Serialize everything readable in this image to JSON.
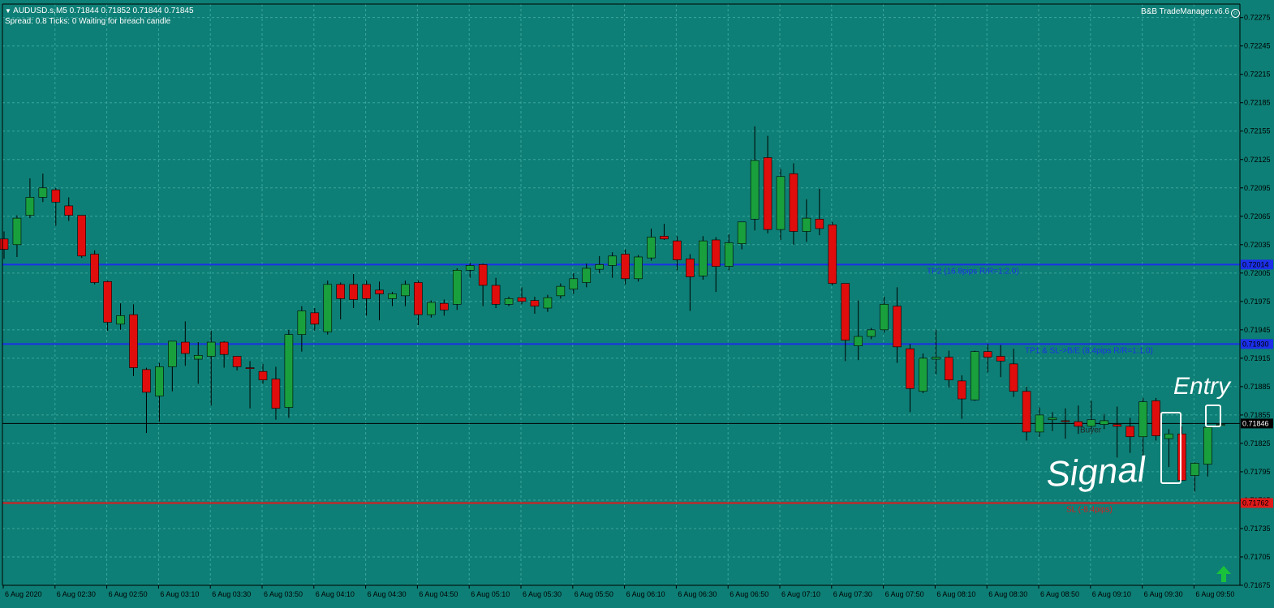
{
  "header": {
    "symbol_line": "AUDUSD.s,M5  0.71844 0.71852 0.71844 0.71845",
    "status_line": "Spread: 0.8   Ticks: 0   Waiting for breach candle",
    "ea_name": "B&B TradeManager.v6.6"
  },
  "colors": {
    "background": "#0e7f76",
    "grid": "#3aa79d",
    "bull_candle": "#19a03c",
    "bear_candle": "#e00d0d",
    "tp_line": "#1b30e8",
    "sl_line": "#e01a1a",
    "price_line": "#000000",
    "annotation": "#ffffff"
  },
  "levels": {
    "tp2": {
      "price": 0.72014,
      "tag": "0.72014",
      "label": "TP2 (16.8pips R/R=1:2.0)"
    },
    "tp1": {
      "price": 0.7193,
      "tag": "0.71930",
      "label": "TP1 & SL->B/E (8.4pips R/R=1:1.0)"
    },
    "current": {
      "price": 0.71846,
      "tag": "0.71846"
    },
    "sl": {
      "price": 0.71762,
      "tag": "0.71762",
      "label": "SL (-8.4pips)"
    },
    "order_label": "Buyer"
  },
  "annotations": {
    "signal": "Signal",
    "entry": "Entry"
  },
  "chart_data": {
    "type": "candlestick",
    "symbol": "AUDUSD.s",
    "timeframe": "M5",
    "ylim": [
      0.71675,
      0.72285
    ],
    "y_ticks": [
      "0.72275",
      "0.72245",
      "0.72215",
      "0.72185",
      "0.72155",
      "0.72125",
      "0.72095",
      "0.72065",
      "0.72035",
      "0.72005",
      "0.71975",
      "0.71945",
      "0.71915",
      "0.71885",
      "0.71855",
      "0.71825",
      "0.71795",
      "0.71765",
      "0.71735",
      "0.71705",
      "0.71675"
    ],
    "x_ticks": [
      "6 Aug 2020",
      "6 Aug 02:30",
      "6 Aug 02:50",
      "6 Aug 03:10",
      "6 Aug 03:30",
      "6 Aug 03:50",
      "6 Aug 04:10",
      "6 Aug 04:30",
      "6 Aug 04:50",
      "6 Aug 05:10",
      "6 Aug 05:30",
      "6 Aug 05:50",
      "6 Aug 06:10",
      "6 Aug 06:30",
      "6 Aug 06:50",
      "6 Aug 07:10",
      "6 Aug 07:30",
      "6 Aug 07:50",
      "6 Aug 08:10",
      "6 Aug 08:30",
      "6 Aug 08:50",
      "6 Aug 09:10",
      "6 Aug 09:30",
      "6 Aug 09:50"
    ],
    "grid": true,
    "candles": [
      {
        "o": 0.72041,
        "h": 0.72049,
        "l": 0.7202,
        "c": 0.7203
      },
      {
        "o": 0.72035,
        "h": 0.72066,
        "l": 0.72022,
        "c": 0.72063
      },
      {
        "o": 0.72066,
        "h": 0.72105,
        "l": 0.72063,
        "c": 0.72085
      },
      {
        "o": 0.72085,
        "h": 0.7211,
        "l": 0.7208,
        "c": 0.72095
      },
      {
        "o": 0.72093,
        "h": 0.72095,
        "l": 0.72055,
        "c": 0.7208
      },
      {
        "o": 0.72076,
        "h": 0.72085,
        "l": 0.7206,
        "c": 0.72066
      },
      {
        "o": 0.72066,
        "h": 0.72066,
        "l": 0.72021,
        "c": 0.72023
      },
      {
        "o": 0.72025,
        "h": 0.72029,
        "l": 0.71993,
        "c": 0.71995
      },
      {
        "o": 0.71996,
        "h": 0.71997,
        "l": 0.71944,
        "c": 0.71953
      },
      {
        "o": 0.71951,
        "h": 0.71973,
        "l": 0.71945,
        "c": 0.7196
      },
      {
        "o": 0.71961,
        "h": 0.71972,
        "l": 0.71896,
        "c": 0.71905
      },
      {
        "o": 0.71903,
        "h": 0.71905,
        "l": 0.71836,
        "c": 0.71879
      },
      {
        "o": 0.71875,
        "h": 0.7191,
        "l": 0.71848,
        "c": 0.71906
      },
      {
        "o": 0.71906,
        "h": 0.71933,
        "l": 0.7188,
        "c": 0.71933
      },
      {
        "o": 0.71932,
        "h": 0.71954,
        "l": 0.71907,
        "c": 0.7192
      },
      {
        "o": 0.71914,
        "h": 0.71932,
        "l": 0.71888,
        "c": 0.71918
      },
      {
        "o": 0.71917,
        "h": 0.71944,
        "l": 0.71865,
        "c": 0.71932
      },
      {
        "o": 0.71932,
        "h": 0.71933,
        "l": 0.71905,
        "c": 0.71919
      },
      {
        "o": 0.71917,
        "h": 0.71917,
        "l": 0.71902,
        "c": 0.71906
      },
      {
        "o": 0.71905,
        "h": 0.71912,
        "l": 0.71862,
        "c": 0.71904
      },
      {
        "o": 0.71901,
        "h": 0.71909,
        "l": 0.71888,
        "c": 0.71892
      },
      {
        "o": 0.71893,
        "h": 0.71906,
        "l": 0.7185,
        "c": 0.71862
      },
      {
        "o": 0.71863,
        "h": 0.71945,
        "l": 0.71852,
        "c": 0.7194
      },
      {
        "o": 0.7194,
        "h": 0.7197,
        "l": 0.71922,
        "c": 0.71965
      },
      {
        "o": 0.71963,
        "h": 0.71968,
        "l": 0.71944,
        "c": 0.71951
      },
      {
        "o": 0.71943,
        "h": 0.71997,
        "l": 0.7194,
        "c": 0.71993
      },
      {
        "o": 0.71993,
        "h": 0.71995,
        "l": 0.71956,
        "c": 0.71978
      },
      {
        "o": 0.71993,
        "h": 0.72004,
        "l": 0.71968,
        "c": 0.71977
      },
      {
        "o": 0.71993,
        "h": 0.71997,
        "l": 0.7196,
        "c": 0.71978
      },
      {
        "o": 0.71987,
        "h": 0.71996,
        "l": 0.71955,
        "c": 0.71983
      },
      {
        "o": 0.71978,
        "h": 0.71985,
        "l": 0.7197,
        "c": 0.71983
      },
      {
        "o": 0.71981,
        "h": 0.71997,
        "l": 0.7197,
        "c": 0.71993
      },
      {
        "o": 0.71995,
        "h": 0.71997,
        "l": 0.7195,
        "c": 0.71961
      },
      {
        "o": 0.71961,
        "h": 0.71976,
        "l": 0.71958,
        "c": 0.71974
      },
      {
        "o": 0.71973,
        "h": 0.71977,
        "l": 0.7196,
        "c": 0.71966
      },
      {
        "o": 0.71972,
        "h": 0.7201,
        "l": 0.71966,
        "c": 0.72008
      },
      {
        "o": 0.72008,
        "h": 0.72016,
        "l": 0.72,
        "c": 0.72013
      },
      {
        "o": 0.72014,
        "h": 0.72015,
        "l": 0.7197,
        "c": 0.71992
      },
      {
        "o": 0.71992,
        "h": 0.72,
        "l": 0.71968,
        "c": 0.71972
      },
      {
        "o": 0.71972,
        "h": 0.7198,
        "l": 0.7197,
        "c": 0.71978
      },
      {
        "o": 0.71979,
        "h": 0.7199,
        "l": 0.71972,
        "c": 0.71975
      },
      {
        "o": 0.71976,
        "h": 0.7198,
        "l": 0.71962,
        "c": 0.7197
      },
      {
        "o": 0.71968,
        "h": 0.71982,
        "l": 0.71964,
        "c": 0.71979
      },
      {
        "o": 0.71981,
        "h": 0.71994,
        "l": 0.71978,
        "c": 0.71991
      },
      {
        "o": 0.71988,
        "h": 0.72005,
        "l": 0.71983,
        "c": 0.71999
      },
      {
        "o": 0.71995,
        "h": 0.72015,
        "l": 0.7199,
        "c": 0.7201
      },
      {
        "o": 0.72009,
        "h": 0.72023,
        "l": 0.72005,
        "c": 0.72014
      },
      {
        "o": 0.72013,
        "h": 0.72027,
        "l": 0.72,
        "c": 0.72023
      },
      {
        "o": 0.72025,
        "h": 0.7203,
        "l": 0.71993,
        "c": 0.71999
      },
      {
        "o": 0.71999,
        "h": 0.72024,
        "l": 0.71996,
        "c": 0.72022
      },
      {
        "o": 0.72021,
        "h": 0.72052,
        "l": 0.72018,
        "c": 0.72043
      },
      {
        "o": 0.72044,
        "h": 0.72057,
        "l": 0.7204,
        "c": 0.72041
      },
      {
        "o": 0.72039,
        "h": 0.72044,
        "l": 0.72008,
        "c": 0.72019
      },
      {
        "o": 0.7202,
        "h": 0.72025,
        "l": 0.71965,
        "c": 0.72001
      },
      {
        "o": 0.72002,
        "h": 0.72044,
        "l": 0.71998,
        "c": 0.72039
      },
      {
        "o": 0.7204,
        "h": 0.72043,
        "l": 0.71985,
        "c": 0.72012
      },
      {
        "o": 0.72012,
        "h": 0.72046,
        "l": 0.72008,
        "c": 0.72037
      },
      {
        "o": 0.72036,
        "h": 0.72059,
        "l": 0.7203,
        "c": 0.72059
      },
      {
        "o": 0.72062,
        "h": 0.7216,
        "l": 0.7205,
        "c": 0.72124
      },
      {
        "o": 0.72127,
        "h": 0.7215,
        "l": 0.72047,
        "c": 0.72051
      },
      {
        "o": 0.72051,
        "h": 0.72115,
        "l": 0.7204,
        "c": 0.72107
      },
      {
        "o": 0.7211,
        "h": 0.72121,
        "l": 0.72035,
        "c": 0.72049
      },
      {
        "o": 0.72049,
        "h": 0.72083,
        "l": 0.72038,
        "c": 0.72063
      },
      {
        "o": 0.72062,
        "h": 0.72094,
        "l": 0.72045,
        "c": 0.72052
      },
      {
        "o": 0.72056,
        "h": 0.72059,
        "l": 0.71992,
        "c": 0.71994
      },
      {
        "o": 0.71994,
        "h": 0.71994,
        "l": 0.71912,
        "c": 0.71934
      },
      {
        "o": 0.71928,
        "h": 0.71976,
        "l": 0.71913,
        "c": 0.71938
      },
      {
        "o": 0.71938,
        "h": 0.71947,
        "l": 0.71935,
        "c": 0.71945
      },
      {
        "o": 0.71945,
        "h": 0.7198,
        "l": 0.71942,
        "c": 0.71972
      },
      {
        "o": 0.7197,
        "h": 0.7199,
        "l": 0.7191,
        "c": 0.71927
      },
      {
        "o": 0.71925,
        "h": 0.7193,
        "l": 0.71858,
        "c": 0.71883
      },
      {
        "o": 0.7188,
        "h": 0.7192,
        "l": 0.71878,
        "c": 0.71915
      },
      {
        "o": 0.71914,
        "h": 0.71945,
        "l": 0.71898,
        "c": 0.71916
      },
      {
        "o": 0.71916,
        "h": 0.71923,
        "l": 0.71884,
        "c": 0.71892
      },
      {
        "o": 0.71891,
        "h": 0.71897,
        "l": 0.71851,
        "c": 0.71872
      },
      {
        "o": 0.71871,
        "h": 0.71923,
        "l": 0.7187,
        "c": 0.71922
      },
      {
        "o": 0.71922,
        "h": 0.7193,
        "l": 0.719,
        "c": 0.71916
      },
      {
        "o": 0.71917,
        "h": 0.71929,
        "l": 0.71895,
        "c": 0.71912
      },
      {
        "o": 0.71909,
        "h": 0.71925,
        "l": 0.71874,
        "c": 0.7188
      },
      {
        "o": 0.7188,
        "h": 0.71885,
        "l": 0.71828,
        "c": 0.71837
      },
      {
        "o": 0.71837,
        "h": 0.71863,
        "l": 0.71832,
        "c": 0.71855
      },
      {
        "o": 0.7185,
        "h": 0.71858,
        "l": 0.71838,
        "c": 0.71852
      },
      {
        "o": 0.71849,
        "h": 0.71862,
        "l": 0.7183,
        "c": 0.71848
      },
      {
        "o": 0.71848,
        "h": 0.71865,
        "l": 0.71835,
        "c": 0.71843
      },
      {
        "o": 0.71843,
        "h": 0.7187,
        "l": 0.7184,
        "c": 0.7185
      },
      {
        "o": 0.71845,
        "h": 0.71856,
        "l": 0.7184,
        "c": 0.71849
      },
      {
        "o": 0.71845,
        "h": 0.71864,
        "l": 0.7181,
        "c": 0.71843
      },
      {
        "o": 0.71843,
        "h": 0.71852,
        "l": 0.71815,
        "c": 0.71832
      },
      {
        "o": 0.71832,
        "h": 0.71873,
        "l": 0.7181,
        "c": 0.71869
      },
      {
        "o": 0.7187,
        "h": 0.71873,
        "l": 0.71828,
        "c": 0.71833
      },
      {
        "o": 0.7183,
        "h": 0.7184,
        "l": 0.718,
        "c": 0.71835
      },
      {
        "o": 0.71835,
        "h": 0.71843,
        "l": 0.71785,
        "c": 0.71786
      },
      {
        "o": 0.71791,
        "h": 0.71805,
        "l": 0.71774,
        "c": 0.71804
      },
      {
        "o": 0.71803,
        "h": 0.7184,
        "l": 0.7179,
        "c": 0.71842
      },
      {
        "o": 0.71844,
        "h": 0.71852,
        "l": 0.71844,
        "c": 0.71845
      }
    ]
  }
}
